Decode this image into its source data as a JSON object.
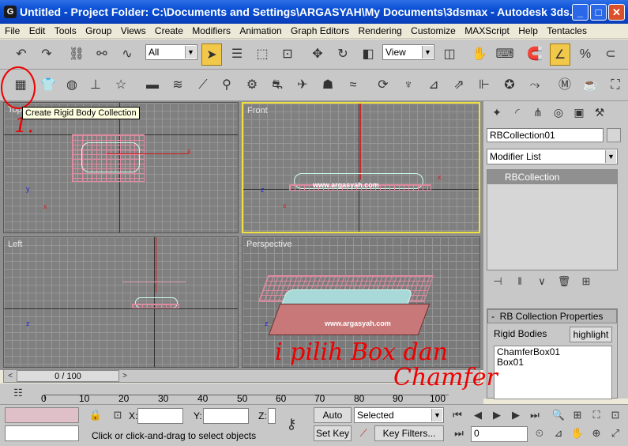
{
  "window": {
    "title": "Untitled     - Project Folder: C:\\Documents and Settings\\ARGASYAH\\My Documents\\3dsmax     - Autodesk 3ds...",
    "minimize": "_",
    "maximize": "□",
    "close": "✕"
  },
  "menu": [
    "File",
    "Edit",
    "Tools",
    "Group",
    "Views",
    "Create",
    "Modifiers",
    "Animation",
    "Graph Editors",
    "Rendering",
    "Customize",
    "MAXScript",
    "Help",
    "Tentacles"
  ],
  "toolbar": {
    "selection_filter": "All",
    "reference_coord": "View"
  },
  "tooltip": "Create Rigid Body Collection",
  "viewports": {
    "top": "Top",
    "front": "Front",
    "left": "Left",
    "perspective": "Perspective"
  },
  "watermark": "www.argasyah.com",
  "command_panel": {
    "object_name": "RBCollection01",
    "modifier_list": "Modifier List",
    "stack_item": "RBCollection",
    "rollout_title": "RB Collection Properties",
    "rollout_minus": "-",
    "rigid_bodies_label": "Rigid Bodies",
    "highlight_button": "highlight",
    "bodies": [
      "ChamferBox01",
      "Box01"
    ]
  },
  "time_slider": {
    "position": "0 / 100",
    "prev": "<",
    "next": ">"
  },
  "track_ticks": [
    "0",
    "10",
    "20",
    "30",
    "40",
    "50",
    "60",
    "70",
    "80",
    "90",
    "100"
  ],
  "status": {
    "x_label": "X:",
    "y_label": "Y:",
    "z_label": "Z:",
    "auto_key": "Auto Key",
    "set_key": "Set Key",
    "key_mode": "Selected",
    "key_filters": "Key Filters...",
    "frame": "0",
    "prompt": "Click or click-and-drag to select objects"
  },
  "annotations": {
    "step_number": "1.",
    "note_line1": "i pilih Box dan",
    "note_line2": "Chamfer"
  }
}
